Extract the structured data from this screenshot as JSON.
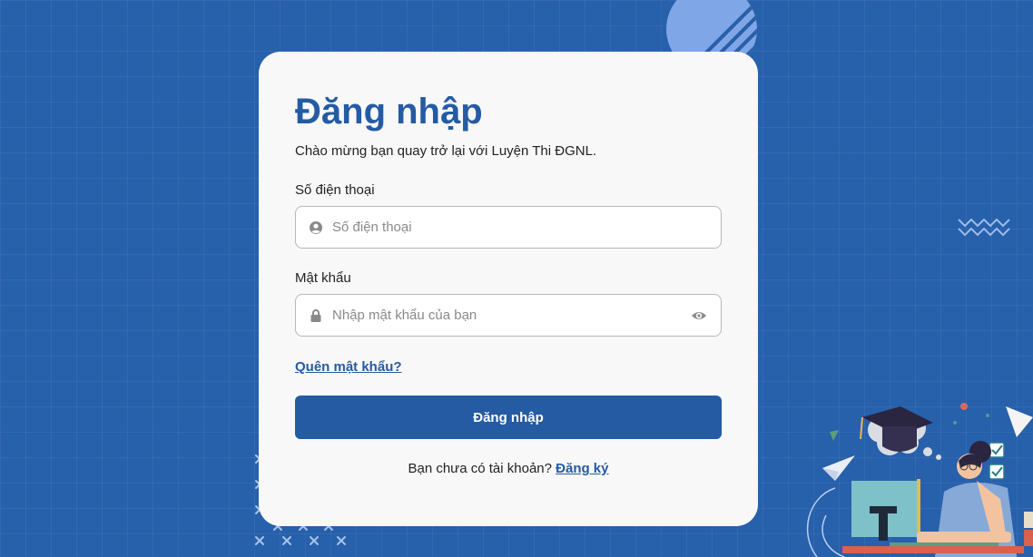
{
  "login": {
    "title": "Đăng nhập",
    "subtitle": "Chào mừng bạn quay trở lại với Luyện Thi ĐGNL.",
    "phone": {
      "label": "Số điện thoại",
      "placeholder": "Số điện thoại",
      "value": "",
      "icon": "user-circle-icon"
    },
    "password": {
      "label": "Mật khẩu",
      "placeholder": "Nhập mật khẩu của bạn",
      "value": "",
      "icon": "lock-icon",
      "toggle_icon": "eye-icon"
    },
    "forgot_link": "Quên mật khẩu?",
    "submit_label": "Đăng nhập",
    "signup_prompt": "Bạn chưa có tài khoản?",
    "signup_link": "Đăng ký"
  },
  "colors": {
    "background": "#2760ab",
    "primary": "#245ba3",
    "card": "#f8f8f8"
  }
}
